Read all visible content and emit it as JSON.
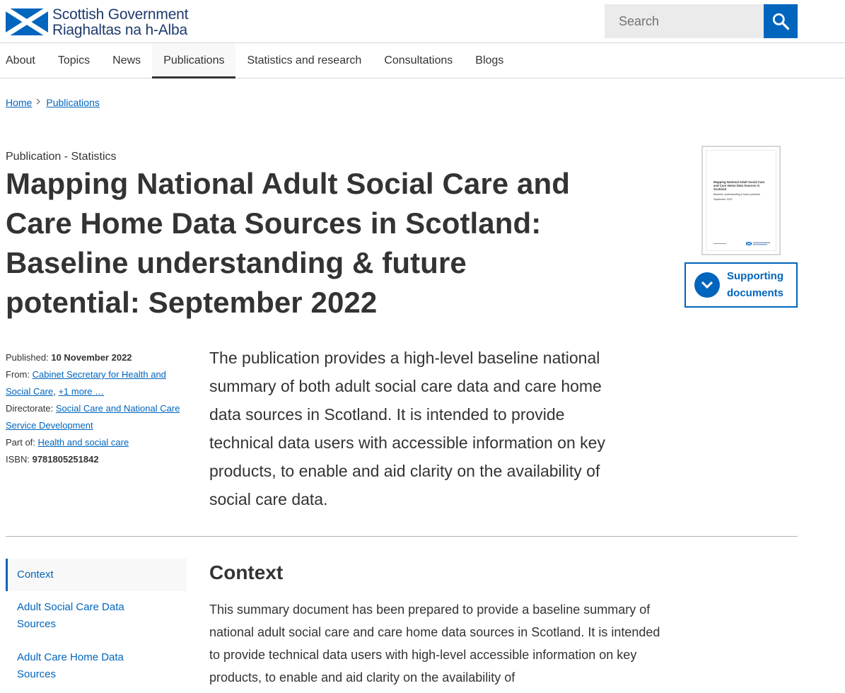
{
  "header": {
    "logo_line1": "Scottish Government",
    "logo_line2": "Riaghaltas na h-Alba",
    "search_placeholder": "Search"
  },
  "nav": {
    "items": [
      "About",
      "Topics",
      "News",
      "Publications",
      "Statistics and research",
      "Consultations",
      "Blogs"
    ],
    "active": "Publications"
  },
  "breadcrumb": {
    "items": [
      "Home",
      "Publications"
    ]
  },
  "publication": {
    "label": "Publication - Statistics",
    "title": "Mapping National Adult Social Care and Care Home Data Sources in Scotland: Baseline understanding & future potential: September 2022",
    "cover": {
      "title": "Mapping National Adult Social Care and Care Home Data Sources in Scotland",
      "subtitle": "Baseline understanding & future potential",
      "date": "September 2022"
    },
    "supporting_label": "Supporting documents",
    "meta": {
      "published_label": "Published:",
      "published_value": "10 November 2022",
      "from_label": "From:",
      "from_link": "Cabinet Secretary for Health and Social Care",
      "from_more": "+1 more …",
      "directorate_label": "Directorate:",
      "directorate_link": "Social Care and National Care Service Development",
      "part_of_label": "Part of:",
      "part_of_link": "Health and social care",
      "isbn_label": "ISBN:",
      "isbn_value": "9781805251842"
    },
    "lead": "The publication provides a high-level baseline national summary of both adult social care data and care home data sources in Scotland. It is intended to provide technical data users with accessible information on key products, to enable and aid clarity on the availability of social care data."
  },
  "contents": {
    "items": [
      "Context",
      "Adult Social Care Data Sources",
      "Adult Care Home Data Sources"
    ],
    "current": "Context"
  },
  "section": {
    "heading": "Context",
    "body": "This summary document has been prepared to provide a baseline summary of national adult social care and care home data sources in Scotland. It is intended to provide technical data users with high-level accessible information on key products, to enable and aid clarity on the availability of"
  },
  "colors": {
    "link_blue": "#0065bd",
    "logo_navy": "#1e3a6e",
    "text": "#333333"
  }
}
